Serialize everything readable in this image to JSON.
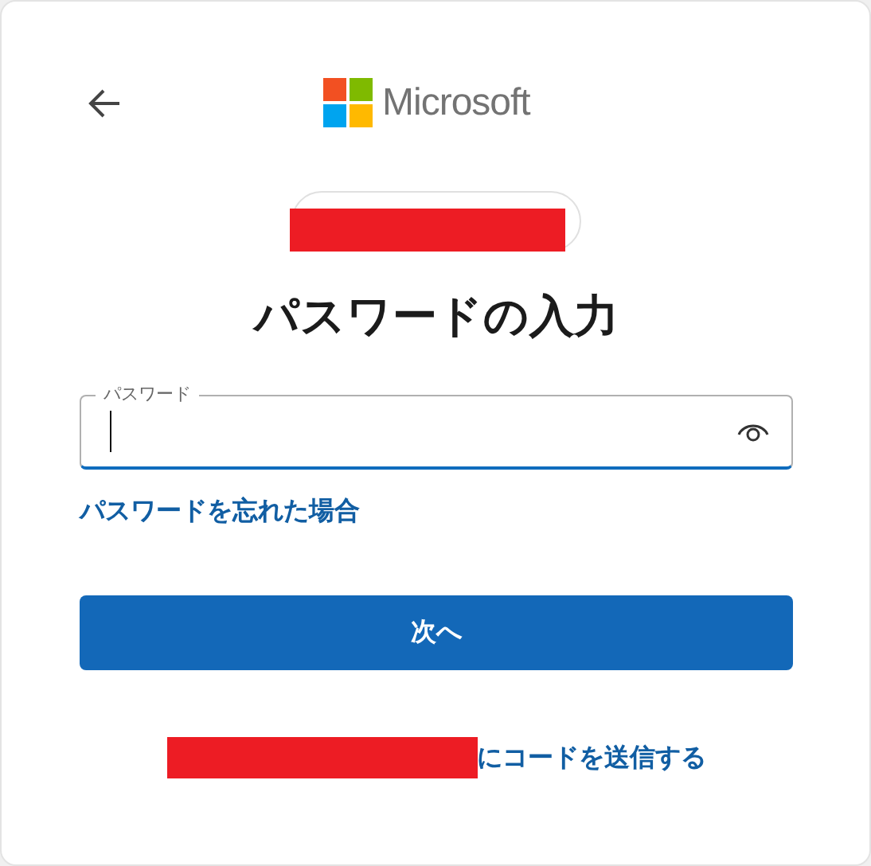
{
  "brand": {
    "name": "Microsoft"
  },
  "title": "パスワードの入力",
  "password_field": {
    "label": "パスワード",
    "focused": true
  },
  "forgot_link": "パスワードを忘れた場合",
  "next_button": "次へ",
  "send_code_link": "にコードを送信する"
}
